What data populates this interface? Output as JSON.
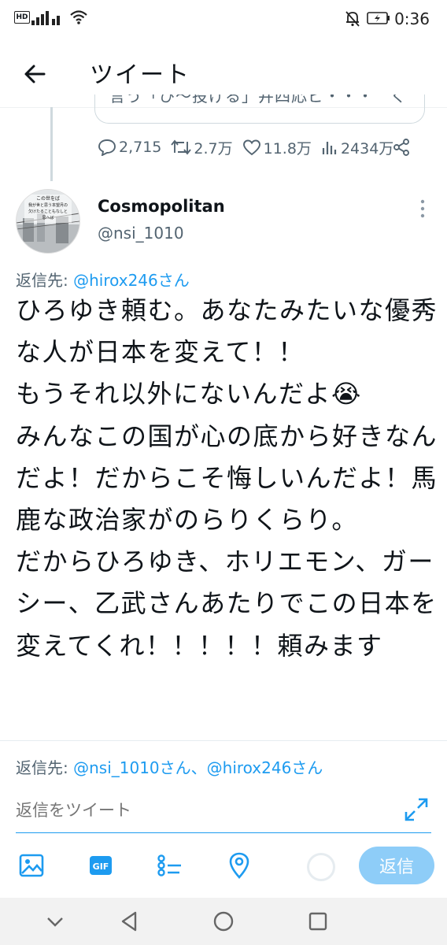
{
  "status_bar": {
    "hd": "HD",
    "time": "0:36"
  },
  "header": {
    "title": "ツイート"
  },
  "prev_tweet": {
    "card_fragment": "言う「ひ〜投げる」井四応ビ・・・　く",
    "stats": {
      "replies": "2,715",
      "retweets": "2.7万",
      "likes": "11.8万",
      "views": "2434万"
    }
  },
  "tweet": {
    "author_name": "Cosmopolitan",
    "author_handle": "@nsi_1010",
    "reply_to_label": "返信先: ",
    "reply_to_user": "@hirox246さん",
    "body": "ひろゆき頼む。あなたみたいな優秀な人が日本を変えて！！\nもうそれ以外にないんだよ😭\nみんなこの国が心の底から好きなんだよ！だからこそ悔しいんだよ！馬鹿な政治家がのらりくらり。\nだからひろゆき、ホリエモン、ガーシー、乙武さんあたりでこの日本を変えてくれ！！！！！頼みます",
    "avatar_lines": [
      "この世をば",
      "我が世と思う本望月の",
      "欠けたることもなしと",
      "思へば"
    ]
  },
  "composer": {
    "reply_to_label": "返信先: ",
    "reply_to_users": "@nsi_1010さん、@hirox246さん",
    "placeholder": "返信をツイート",
    "reply_button": "返信"
  },
  "colors": {
    "accent": "#1d9bf0",
    "muted": "#536471",
    "reply_button_disabled": "#8ecdf8"
  },
  "icons": [
    "back-arrow-icon",
    "reply-icon",
    "retweet-icon",
    "like-icon",
    "views-icon",
    "share-icon",
    "more-vertical-icon",
    "image-icon",
    "gif-icon",
    "poll-icon",
    "location-icon",
    "expand-icon"
  ]
}
